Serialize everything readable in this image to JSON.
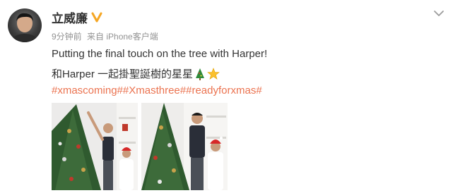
{
  "post": {
    "author": "立威廉",
    "time": "9分钟前",
    "source": "来自 iPhone客户端",
    "line1": "Putting the final touch on the tree with Harper!",
    "line2": "和Harper 一起掛聖誕樹的星星",
    "hashtags": [
      "#xmascoming#",
      "#Xmasthree#",
      "#readyforxmas#"
    ],
    "emojis": [
      "christmas-tree-icon",
      "star-icon"
    ],
    "photos": [
      "photo-1",
      "photo-2"
    ]
  },
  "colors": {
    "name": "#333333",
    "meta": "#939393",
    "hashtag": "#eb7350",
    "verified": "#f5a623"
  }
}
